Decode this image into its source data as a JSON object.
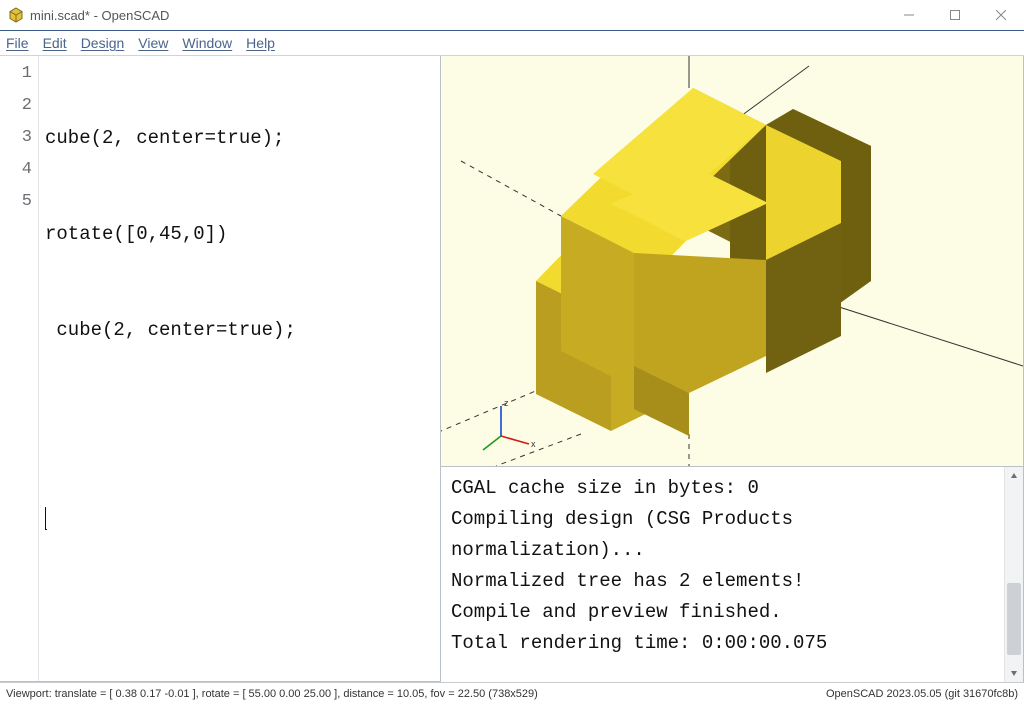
{
  "window": {
    "title": "mini.scad* - OpenSCAD"
  },
  "menubar": {
    "items": [
      "File",
      "Edit",
      "Design",
      "View",
      "Window",
      "Help"
    ]
  },
  "editor": {
    "line_numbers": [
      "1",
      "2",
      "3",
      "4",
      "5"
    ],
    "lines": [
      "cube(2, center=true);",
      "rotate([0,45,0])",
      " cube(2, center=true);",
      "",
      ""
    ]
  },
  "console": {
    "lines": [
      "CGAL cache size in bytes: 0",
      "Compiling design (CSG Products normalization)...",
      "Normalized tree has 2 elements!",
      "Compile and preview finished.",
      "Total rendering time: 0:00:00.075"
    ]
  },
  "statusbar": {
    "left": "Viewport: translate = [ 0.38 0.17 -0.01 ], rotate = [ 55.00 0.00 25.00 ], distance = 10.05, fov = 22.50 (738x529)",
    "right": "OpenSCAD 2023.05.05 (git 31670fc8b)"
  },
  "viewport_axes": {
    "z": "z",
    "x": "x"
  }
}
